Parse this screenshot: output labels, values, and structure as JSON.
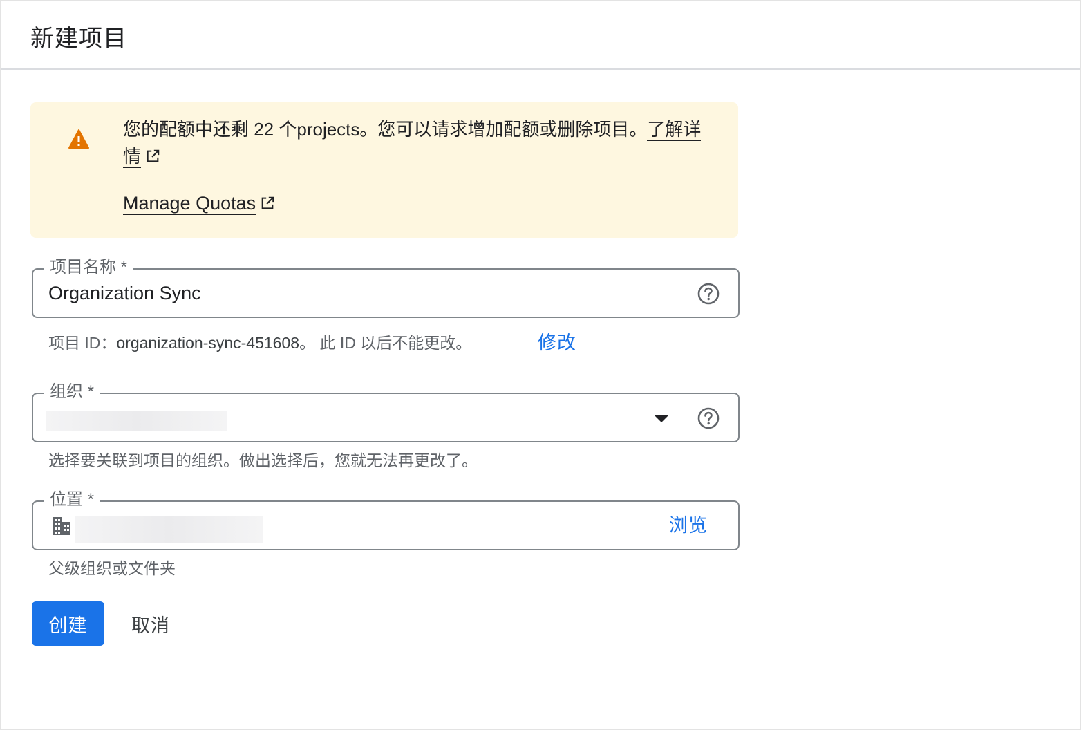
{
  "header": {
    "title": "新建项目"
  },
  "banner": {
    "message": "您的配额中还剩 22 个projects。您可以请求增加配额或删除项目。",
    "learn_more": "了解详情",
    "manage_quotas": "Manage Quotas",
    "icons": {
      "warning": "warning-triangle-icon",
      "external": "open-in-new-icon"
    },
    "colors": {
      "background": "#fef7e0",
      "warning": "#e37400"
    }
  },
  "project_name": {
    "label": "项目名称 *",
    "value": "Organization Sync"
  },
  "project_id": {
    "prefix": "项目 ID：",
    "id": "organization-sync-451608",
    "suffix": "。 此 ID 以后不能更改。",
    "edit_label": "修改"
  },
  "organization": {
    "label": "组织 *",
    "hint": "选择要关联到项目的组织。做出选择后，您就无法再更改了。"
  },
  "location": {
    "label": "位置 *",
    "browse_label": "浏览",
    "hint": "父级组织或文件夹"
  },
  "actions": {
    "create_label": "创建",
    "cancel_label": "取消"
  },
  "accent_color": "#1a73e8"
}
